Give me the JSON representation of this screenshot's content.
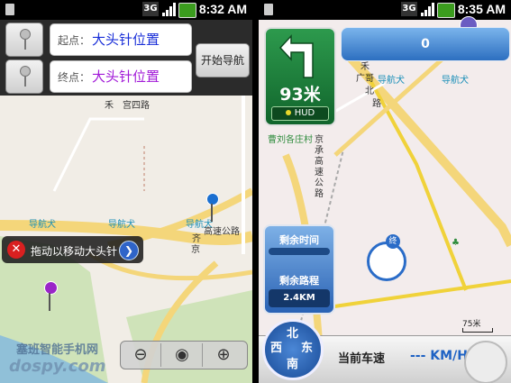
{
  "left_screen": {
    "status_bar": {
      "time": "8:32 AM",
      "network": "3G"
    },
    "route": {
      "start_label": "起点：",
      "start_value": "大头针位置",
      "end_label": "终点：",
      "end_value": "大头针位置",
      "start_nav_button": "开始导航"
    },
    "map_labels": [
      "导航犬",
      "导航犬",
      "导航犬",
      "高速公路",
      "京",
      "齐",
      "宫四路",
      "禾"
    ],
    "drag_tip": "拖动以移动大头针",
    "watermark": "塞班智能手机网",
    "watermark2": "dospy.com"
  },
  "right_screen": {
    "status_bar": {
      "time": "8:35 AM",
      "network": "3G"
    },
    "turn": {
      "distance": "93米",
      "hud_label": "HUD"
    },
    "road_bar_value": "0",
    "map_labels": [
      "禾",
      "广",
      "哥",
      "北",
      "路",
      "导航犬",
      "导航犬",
      "曹刘各庄村",
      "京承高速公路"
    ],
    "info_card": {
      "remaining_time_label": "剩余时间",
      "remaining_distance_label": "剩余路程",
      "remaining_distance_value": "2.4KM"
    },
    "dest_badge": "终",
    "scale": "75米",
    "compass": [
      "西",
      "北",
      "东",
      "南"
    ],
    "speed_label": "当前车速",
    "speed_value": "--- KM/H"
  },
  "colors": {
    "road_yellow": "#f4d67a",
    "route_yellow": "#f0d23a",
    "park_green": "#cfe3b9",
    "water_blue": "#7fb6e0",
    "turn_green": "#1f7d3c",
    "card_blue": "#2a62b4"
  }
}
